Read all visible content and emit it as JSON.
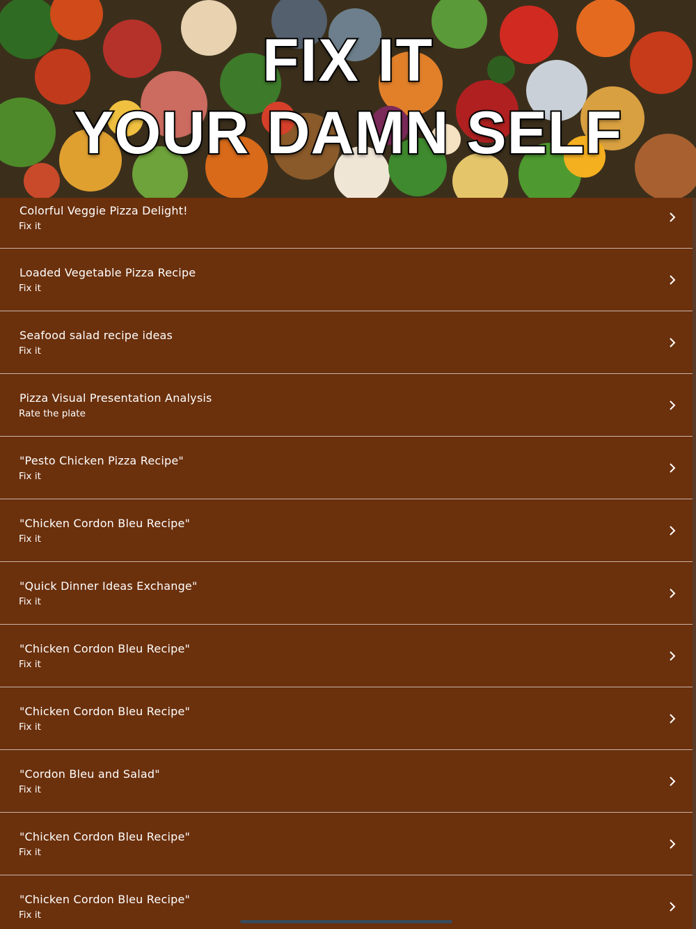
{
  "hero": {
    "line1": "FIX IT",
    "line2": "YOUR DAMN SELF"
  },
  "colors": {
    "background": "#6b300c",
    "divider": "#c9b7ad",
    "text": "#ffffff"
  },
  "items": [
    {
      "title": "Colorful Veggie Pizza Delight!",
      "subtitle": "Fix it"
    },
    {
      "title": "Loaded Vegetable Pizza Recipe",
      "subtitle": "Fix it"
    },
    {
      "title": "Seafood salad recipe ideas",
      "subtitle": "Fix it"
    },
    {
      "title": "Pizza Visual Presentation Analysis",
      "subtitle": "Rate the plate"
    },
    {
      "title": "\"Pesto Chicken Pizza Recipe\"",
      "subtitle": "Fix it"
    },
    {
      "title": "\"Chicken Cordon Bleu Recipe\"",
      "subtitle": "Fix it"
    },
    {
      "title": "\"Quick Dinner Ideas Exchange\"",
      "subtitle": "Fix it"
    },
    {
      "title": "\"Chicken Cordon Bleu Recipe\"",
      "subtitle": "Fix it"
    },
    {
      "title": "\"Chicken Cordon Bleu Recipe\"",
      "subtitle": "Fix it"
    },
    {
      "title": "\"Cordon Bleu and Salad\"",
      "subtitle": "Fix it"
    },
    {
      "title": "\"Chicken Cordon Bleu Recipe\"",
      "subtitle": "Fix it"
    },
    {
      "title": "\"Chicken Cordon Bleu Recipe\"",
      "subtitle": "Fix it"
    }
  ],
  "icons": {
    "row_chevron": "chevron-right-icon"
  }
}
